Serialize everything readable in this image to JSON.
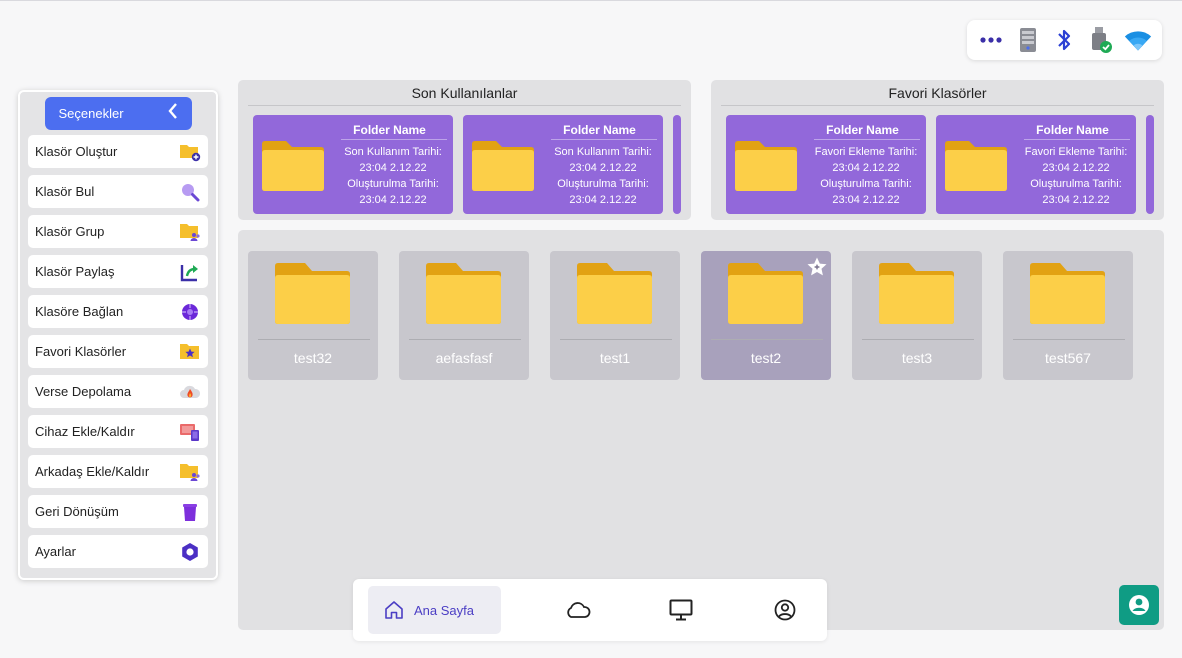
{
  "sidebar": {
    "header_label": "Seçenekler",
    "items": [
      {
        "label": "Klasör Oluştur",
        "icon": "folder-add-icon"
      },
      {
        "label": "Klasör Bul",
        "icon": "search-icon"
      },
      {
        "label": "Klasör Grup",
        "icon": "folder-group-icon"
      },
      {
        "label": "Klasör Paylaş",
        "icon": "share-icon"
      },
      {
        "label": "Klasöre Bağlan",
        "icon": "connect-icon"
      },
      {
        "label": "Favori Klasörler",
        "icon": "folder-star-icon"
      },
      {
        "label": "Verse Depolama",
        "icon": "cloud-storage-icon"
      },
      {
        "label": "Cihaz Ekle/Kaldır",
        "icon": "device-icon"
      },
      {
        "label": "Arkadaş Ekle/Kaldır",
        "icon": "folder-friends-icon"
      },
      {
        "label": "Geri Dönüşüm",
        "icon": "trash-icon"
      },
      {
        "label": "Ayarlar",
        "icon": "settings-icon"
      }
    ]
  },
  "recent": {
    "title": "Son Kullanılanlar",
    "cards": [
      {
        "name": "Folder Name",
        "line1": "Son Kullanım Tarihi:",
        "line2": "23:04 2.12.22",
        "line3": "Oluşturulma Tarihi:",
        "line4": "23:04 2.12.22"
      },
      {
        "name": "Folder Name",
        "line1": "Son Kullanım Tarihi:",
        "line2": "23:04 2.12.22",
        "line3": "Oluşturulma Tarihi:",
        "line4": "23:04 2.12.22"
      }
    ]
  },
  "favorites": {
    "title": "Favori Klasörler",
    "cards": [
      {
        "name": "Folder Name",
        "line1": "Favori Ekleme Tarihi:",
        "line2": "23:04 2.12.22",
        "line3": "Oluşturulma Tarihi:",
        "line4": "23:04 2.12.22"
      },
      {
        "name": "Folder Name",
        "line1": "Favori Ekleme Tarihi:",
        "line2": "23:04 2.12.22",
        "line3": "Oluşturulma Tarihi:",
        "line4": "23:04 2.12.22"
      }
    ]
  },
  "folders": [
    {
      "name": "test32"
    },
    {
      "name": "aefasfasf"
    },
    {
      "name": "test1"
    },
    {
      "name": "test2",
      "selected": true
    },
    {
      "name": "test3"
    },
    {
      "name": "test567"
    }
  ],
  "bottom_nav": {
    "home_label": "Ana Sayfa",
    "items": [
      "home-icon",
      "cloud-icon",
      "monitor-icon",
      "profile-icon"
    ]
  },
  "tray_icons": [
    "more-icon",
    "server-icon",
    "bluetooth-icon",
    "usb-drive-icon",
    "wifi-icon"
  ],
  "colors": {
    "accent": "#4c6ef0",
    "card_purple": "#9268da",
    "folder_yellow": "#f9c735",
    "fab_green": "#0f9c84",
    "nav_active": "#4b3ec4"
  }
}
